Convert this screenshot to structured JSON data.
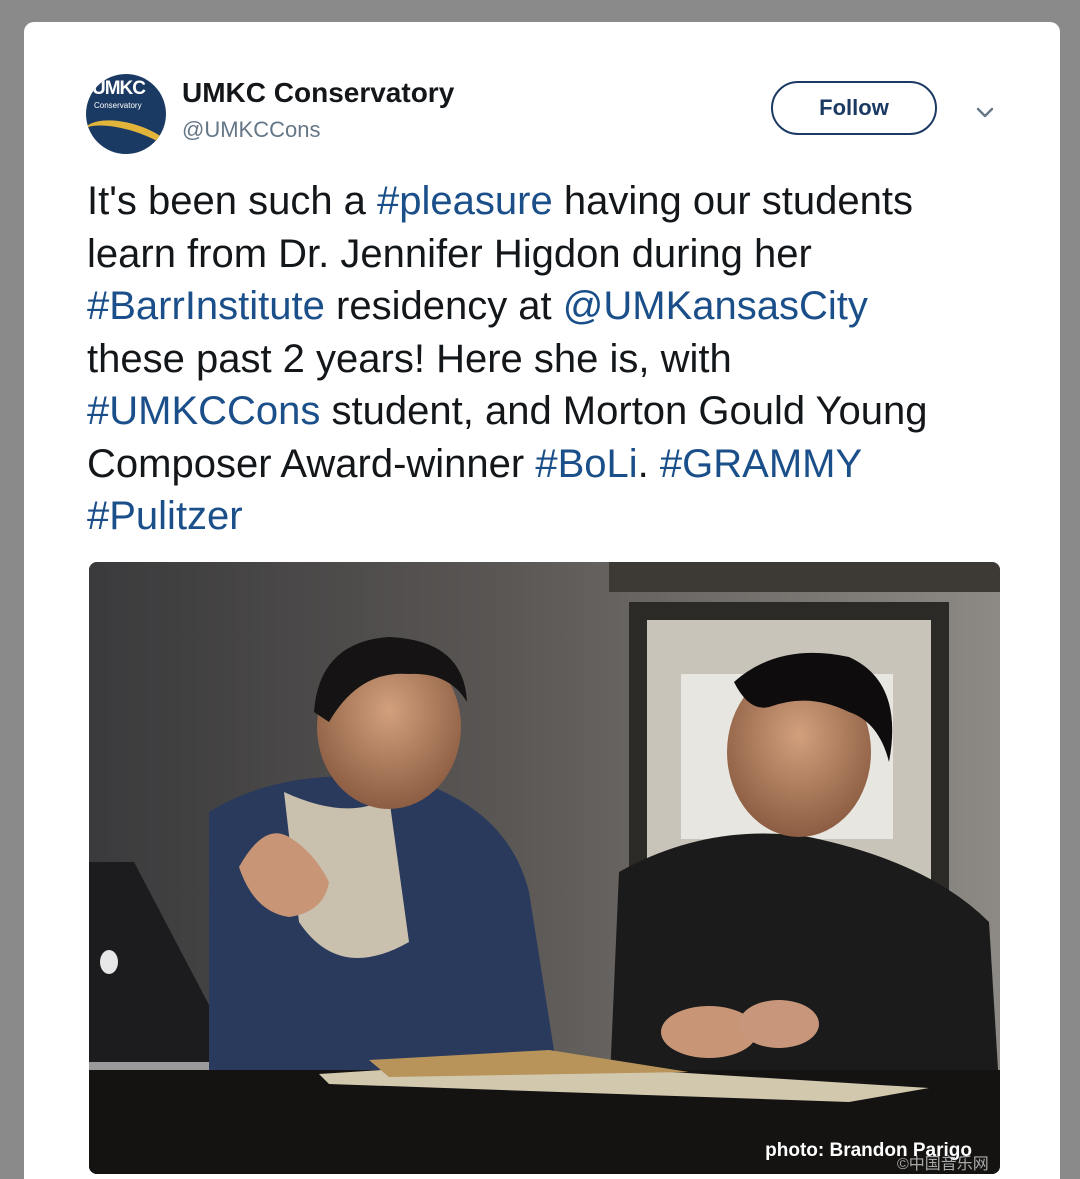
{
  "tweet": {
    "author_name": "UMKC Conservatory",
    "author_handle": "@UMKCCons",
    "avatar_logo_text": "UMKC",
    "avatar_logo_sub": "Conservatory",
    "follow_label": "Follow",
    "text_segments": [
      {
        "t": "It's been such a ",
        "link": false
      },
      {
        "t": "#pleasure",
        "link": true
      },
      {
        "t": " having our students learn from Dr. Jennifer Higdon during her ",
        "link": false
      },
      {
        "t": "#BarrInstitute",
        "link": true
      },
      {
        "t": " residency at ",
        "link": false
      },
      {
        "t": "@UMKansasCity",
        "link": true
      },
      {
        "t": " these past 2 years! Here she is, with ",
        "link": false
      },
      {
        "t": "#UMKCCons",
        "link": true
      },
      {
        "t": " student, and Morton Gould Young Composer Award-winner ",
        "link": false
      },
      {
        "t": "#BoLi",
        "link": true
      },
      {
        "t": ". ",
        "link": false
      },
      {
        "t": "#GRAMMY",
        "link": true
      },
      {
        "t": " ",
        "link": false
      },
      {
        "t": "#Pulitzer",
        "link": true
      }
    ],
    "photo_credit": "photo: Brandon Parigo"
  },
  "watermark_text": "©中国音乐网",
  "colors": {
    "link": "#1b4f8a",
    "brand_navy": "#1b3a63",
    "brand_gold": "#e2b53a",
    "page_bg": "#8a8a8a"
  }
}
